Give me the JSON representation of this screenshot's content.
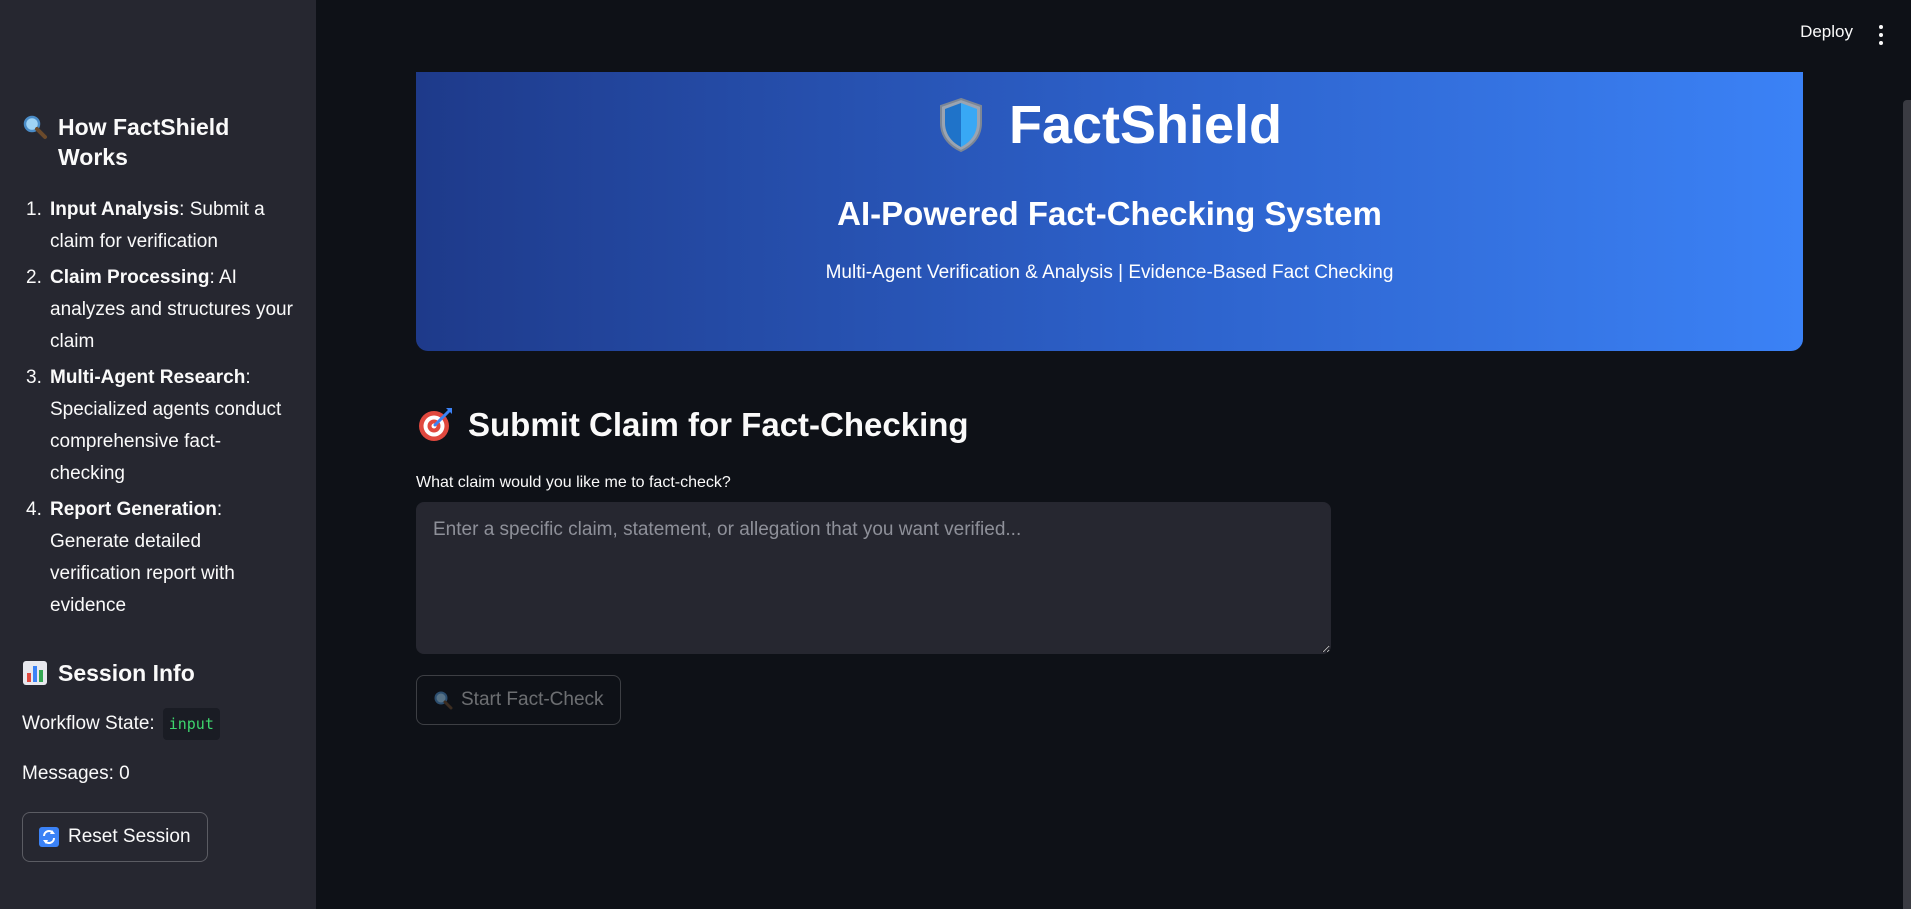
{
  "sidebar": {
    "how_title": "How FactShield Works",
    "steps": [
      {
        "num": "1.",
        "bold": "Input Analysis",
        "text": ": Submit a claim for verification"
      },
      {
        "num": "2.",
        "bold": "Claim Processing",
        "text": ": AI analyzes and structures your claim"
      },
      {
        "num": "3.",
        "bold": "Multi-Agent Research",
        "text": ": Specialized agents conduct comprehensive fact-checking"
      },
      {
        "num": "4.",
        "bold": "Report Generation",
        "text": ": Generate detailed verification report with evidence"
      }
    ],
    "session_title": "Session Info",
    "workflow_label": "Workflow State:",
    "workflow_value": "input",
    "messages_text": "Messages: 0",
    "reset_label": "Reset Session"
  },
  "topbar": {
    "deploy_label": "Deploy"
  },
  "hero": {
    "title": "FactShield",
    "subtitle": "AI-Powered Fact-Checking System",
    "tagline": "Multi-Agent Verification & Analysis | Evidence-Based Fact Checking"
  },
  "form": {
    "section_title": "Submit Claim for Fact-Checking",
    "field_label": "What claim would you like me to fact-check?",
    "placeholder": "Enter a specific claim, statement, or allegation that you want verified...",
    "value": "",
    "submit_label": "Start Fact-Check"
  },
  "icons": {
    "how": "magnifying-glass-icon",
    "session": "bar-chart-icon",
    "reset": "refresh-icon",
    "hero": "shield-icon",
    "section": "target-icon",
    "submit": "magnifying-glass-icon"
  },
  "colors": {
    "background": "#0e1117",
    "sidebar": "#262730",
    "hero_gradient_start": "#1e3a8a",
    "hero_gradient_end": "#3b82f6",
    "code_text": "#3dd56d"
  }
}
